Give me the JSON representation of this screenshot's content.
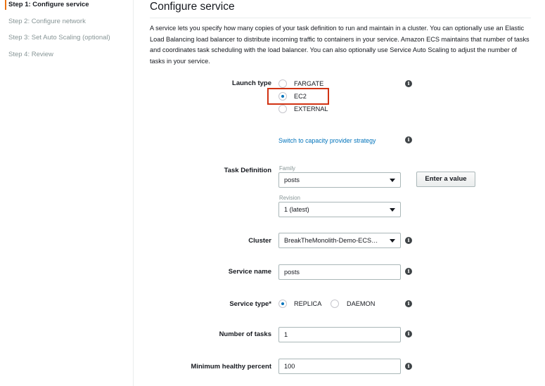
{
  "sidebar": {
    "steps": [
      {
        "label": "Step 1: Configure service",
        "active": true
      },
      {
        "label": "Step 2: Configure network"
      },
      {
        "label": "Step 3: Set Auto Scaling (optional)"
      },
      {
        "label": "Step 4: Review"
      }
    ]
  },
  "main": {
    "title": "Configure service",
    "description": "A service lets you specify how many copies of your task definition to run and maintain in a cluster. You can optionally use an Elastic Load Balancing load balancer to distribute incoming traffic to containers in your service. Amazon ECS maintains that number of tasks and coordinates task scheduling with the load balancer. You can also optionally use Service Auto Scaling to adjust the number of tasks in your service."
  },
  "form": {
    "launch_type": {
      "label": "Launch type",
      "options": [
        "FARGATE",
        "EC2",
        "EXTERNAL"
      ],
      "selected": "EC2"
    },
    "capacity_link": "Switch to capacity provider strategy",
    "task_definition": {
      "label": "Task Definition",
      "family_label": "Family",
      "family_value": "posts",
      "revision_label": "Revision",
      "revision_value": "1 (latest)",
      "enter_value_button": "Enter a value"
    },
    "cluster": {
      "label": "Cluster",
      "value": "BreakTheMonolith-Demo-ECS…"
    },
    "service_name": {
      "label": "Service name",
      "value": "posts"
    },
    "service_type": {
      "label": "Service type*",
      "options": [
        "REPLICA",
        "DAEMON"
      ],
      "selected": "REPLICA"
    },
    "number_of_tasks": {
      "label": "Number of tasks",
      "value": "1"
    },
    "min_healthy_percent": {
      "label": "Minimum healthy percent",
      "value": "100"
    }
  },
  "icons": {
    "info": "info-icon",
    "caret": "chevron-down-icon"
  },
  "colors": {
    "accent": "#ec7211",
    "link": "#0073bb",
    "highlight": "#d13212"
  }
}
